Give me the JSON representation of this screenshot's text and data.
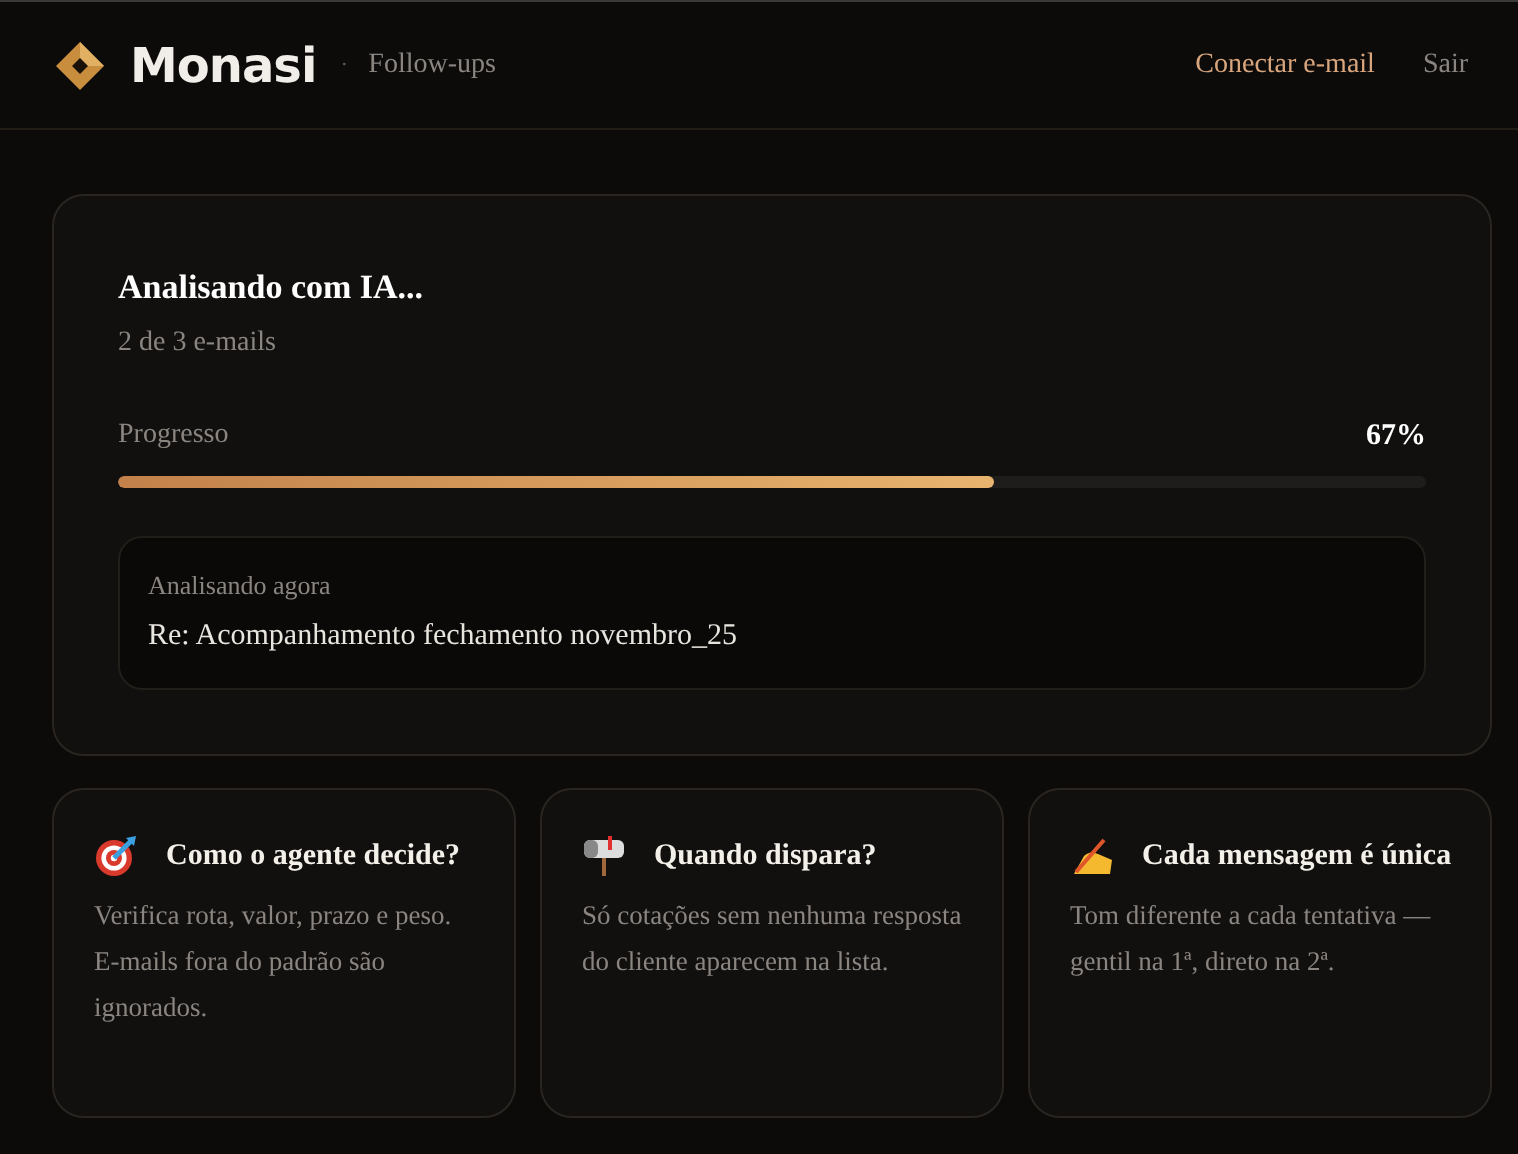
{
  "header": {
    "brand": "Monasi",
    "separator": "·",
    "section": "Follow-ups",
    "links": [
      {
        "label": "Conectar e-mail",
        "kind": "accent"
      },
      {
        "label": "Sair",
        "kind": "muted"
      }
    ]
  },
  "progress_card": {
    "title": "Analisando com IA...",
    "subtitle": "2 de 3 e-mails",
    "progress_label": "Progresso",
    "percent": "67%",
    "level": 0.67,
    "current": {
      "label": "Analisando agora",
      "subject": "Re: Acompanhamento fechamento novembro_25"
    }
  },
  "info_cards": [
    {
      "title": "Como o agente decide?",
      "text": "Verifica rota, valor, prazo e peso. E-mails fora do padrão são ignorados."
    },
    {
      "title": "Quando dispara?",
      "text": "Só cotações sem nenhuma resposta do cliente aparecem na lista."
    },
    {
      "title": "Cada mensagem é única",
      "text": "Tom diferente a cada tentativa — gentil na 1ª, direto na 2ª."
    }
  ]
}
